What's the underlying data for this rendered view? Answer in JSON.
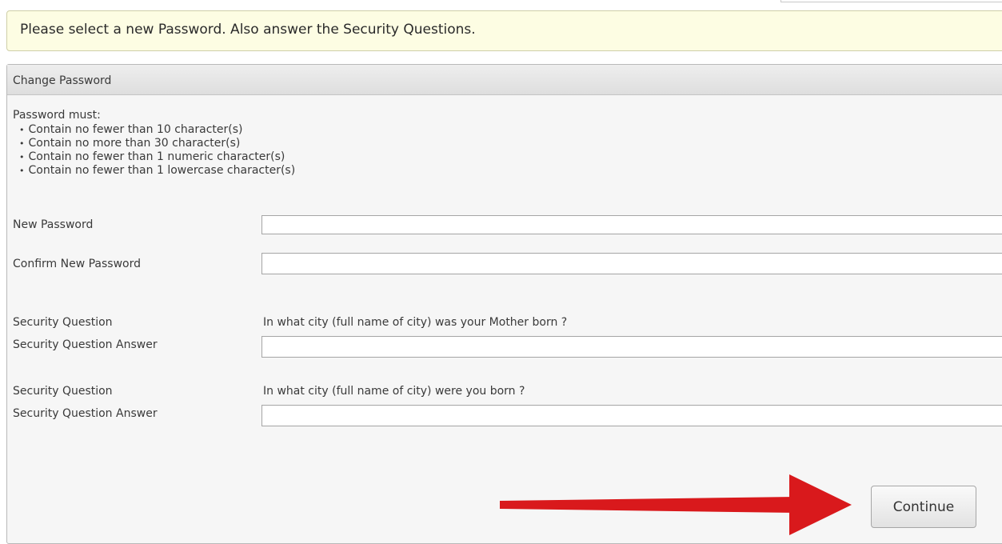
{
  "banner": {
    "message": "Please select a new Password. Also answer the Security Questions."
  },
  "panel": {
    "title": "Change Password",
    "rules_heading": "Password must:",
    "rules": [
      "Contain no fewer than 10 character(s)",
      "Contain no more than 30 character(s)",
      "Contain no fewer than 1 numeric character(s)",
      "Contain no fewer than 1 lowercase character(s)"
    ],
    "new_password_label": "New Password",
    "new_password_value": "",
    "confirm_password_label": "Confirm New Password",
    "confirm_password_value": "",
    "security_questions": [
      {
        "label": "Security Question",
        "question": "In what city (full name of city) was your Mother born ?",
        "answer_label": "Security Question Answer",
        "answer_value": ""
      },
      {
        "label": "Security Question",
        "question": "In what city (full name of city) were you born ?",
        "answer_label": "Security Question Answer",
        "answer_value": ""
      }
    ]
  },
  "actions": {
    "continue_label": "Continue"
  },
  "colors": {
    "banner_background": "#fdfde3",
    "panel_background": "#f6f6f6",
    "arrow": "#d9191c"
  }
}
